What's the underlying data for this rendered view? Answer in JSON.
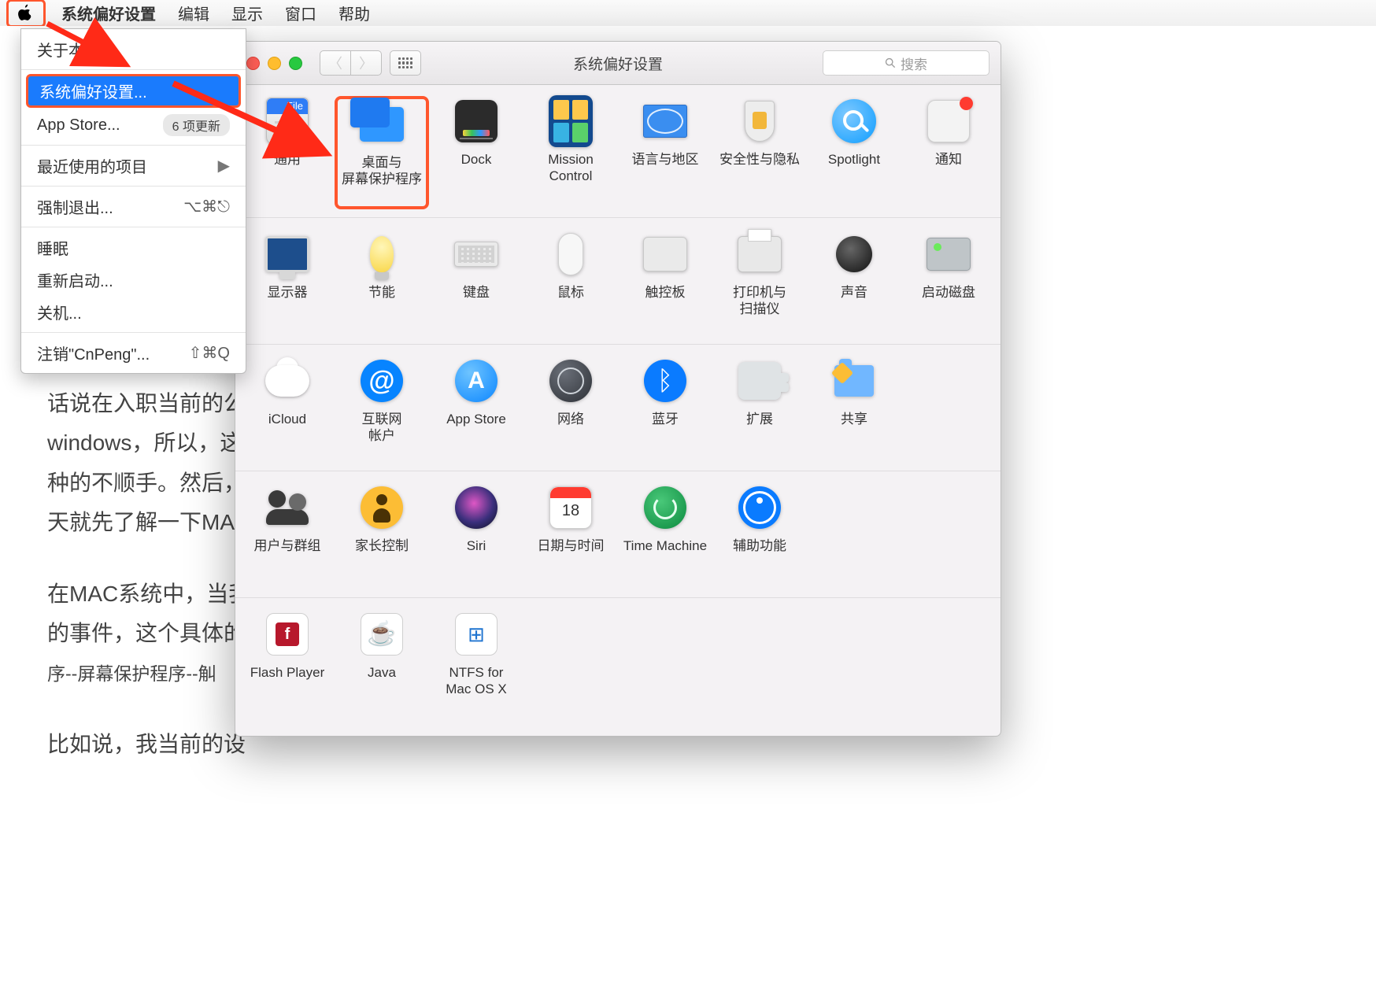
{
  "menubar": {
    "app": "系统偏好设置",
    "items": [
      "编辑",
      "显示",
      "窗口",
      "帮助"
    ]
  },
  "apple_menu": {
    "about": "关于本机",
    "sysprefs": "系统偏好设置...",
    "appstore": "App Store...",
    "appstore_badge": "6 项更新",
    "recent": "最近使用的项目",
    "forcequit": "强制退出...",
    "forcequit_hint": "⌥⌘⎋",
    "sleep": "睡眠",
    "restart": "重新启动...",
    "shutdown": "关机...",
    "logout": "注销\"CnPeng\"...",
    "logout_hint": "⇧⌘Q"
  },
  "editor": {
    "p1": "话说在入职当前的公",
    "p2": "windows，所以，这",
    "p3": "种的不顺手。然后，",
    "p4": "天就先了解一下MA",
    "p5": "在MAC系统中，当我",
    "p6": "的事件，这个具体的",
    "p7": "序--屏幕保护程序--觓",
    "p8": "比如说，我当前的设"
  },
  "prefs": {
    "title": "系统偏好设置",
    "search_placeholder": "搜索",
    "rows": [
      [
        {
          "id": "general",
          "label": "通用"
        },
        {
          "id": "desktop",
          "label": "桌面与\n屏幕保护程序",
          "highlight": true
        },
        {
          "id": "dock",
          "label": "Dock"
        },
        {
          "id": "mission",
          "label": "Mission\nControl"
        },
        {
          "id": "language",
          "label": "语言与地区"
        },
        {
          "id": "security",
          "label": "安全性与隐私"
        },
        {
          "id": "spotlight",
          "label": "Spotlight"
        },
        {
          "id": "notifications",
          "label": "通知"
        }
      ],
      [
        {
          "id": "displays",
          "label": "显示器"
        },
        {
          "id": "energy",
          "label": "节能"
        },
        {
          "id": "keyboard",
          "label": "键盘"
        },
        {
          "id": "mouse",
          "label": "鼠标"
        },
        {
          "id": "trackpad",
          "label": "触控板"
        },
        {
          "id": "printers",
          "label": "打印机与\n扫描仪"
        },
        {
          "id": "sound",
          "label": "声音"
        },
        {
          "id": "startup",
          "label": "启动磁盘"
        }
      ],
      [
        {
          "id": "icloud",
          "label": "iCloud"
        },
        {
          "id": "internet",
          "label": "互联网\n帐户"
        },
        {
          "id": "appstore",
          "label": "App Store"
        },
        {
          "id": "network",
          "label": "网络"
        },
        {
          "id": "bluetooth",
          "label": "蓝牙"
        },
        {
          "id": "extensions",
          "label": "扩展"
        },
        {
          "id": "sharing",
          "label": "共享"
        }
      ],
      [
        {
          "id": "users",
          "label": "用户与群组"
        },
        {
          "id": "parental",
          "label": "家长控制"
        },
        {
          "id": "siri",
          "label": "Siri"
        },
        {
          "id": "datetime",
          "label": "日期与时间"
        },
        {
          "id": "timemachine",
          "label": "Time Machine"
        },
        {
          "id": "accessibility",
          "label": "辅助功能"
        }
      ],
      [
        {
          "id": "flash",
          "label": "Flash Player"
        },
        {
          "id": "java",
          "label": "Java"
        },
        {
          "id": "ntfs",
          "label": "NTFS for\nMac OS X"
        }
      ]
    ]
  }
}
